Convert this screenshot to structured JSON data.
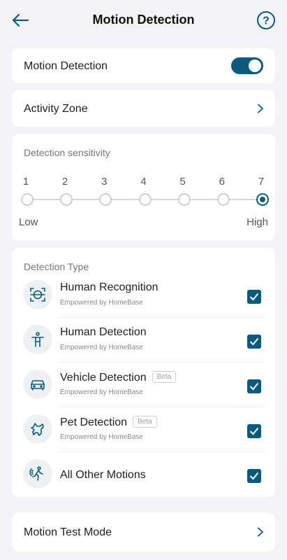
{
  "header": {
    "title": "Motion Detection"
  },
  "motion_toggle": {
    "label": "Motion Detection",
    "enabled": true
  },
  "activity_zone": {
    "label": "Activity Zone"
  },
  "sensitivity": {
    "title": "Detection sensitivity",
    "levels": [
      "1",
      "2",
      "3",
      "4",
      "5",
      "6",
      "7"
    ],
    "selected": 7,
    "low_label": "Low",
    "high_label": "High"
  },
  "detection_type": {
    "title": "Detection Type",
    "items": [
      {
        "name": "Human Recognition",
        "subtitle": "Empowered by HomeBase",
        "beta": "",
        "icon": "face-scan-icon",
        "checked": true
      },
      {
        "name": "Human Detection",
        "subtitle": "Empowered by HomeBase",
        "beta": "",
        "icon": "person-icon",
        "checked": true
      },
      {
        "name": "Vehicle Detection",
        "subtitle": "Empowered by HomeBase",
        "beta": "Beta",
        "icon": "car-icon",
        "checked": true
      },
      {
        "name": "Pet Detection",
        "subtitle": "Empowered by HomeBase",
        "beta": "Beta",
        "icon": "pet-icon",
        "checked": true
      },
      {
        "name": "All Other Motions",
        "subtitle": "",
        "beta": "",
        "icon": "motion-icon",
        "checked": true
      }
    ]
  },
  "test_mode": {
    "label": "Motion Test Mode"
  },
  "colors": {
    "accent": "#0b5a7d",
    "background": "#f3f3f5",
    "card": "#ffffff"
  }
}
